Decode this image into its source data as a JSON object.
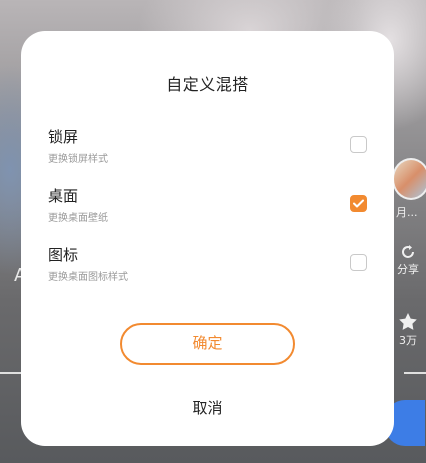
{
  "dialog": {
    "title": "自定义混搭",
    "options": [
      {
        "label": "锁屏",
        "sub": "更换锁屏样式",
        "checked": false
      },
      {
        "label": "桌面",
        "sub": "更换桌面壁纸",
        "checked": true
      },
      {
        "label": "图标",
        "sub": "更换桌面图标样式",
        "checked": false
      }
    ],
    "confirm_label": "确定",
    "cancel_label": "取消"
  },
  "background": {
    "author_snippet": "月...",
    "share_label": "分享",
    "likes_label": "3万",
    "left_char": "A"
  },
  "colors": {
    "accent": "#f28a30",
    "dialog_bg": "#ffffff",
    "text_primary": "#222222",
    "text_secondary": "#9a9a9a"
  }
}
